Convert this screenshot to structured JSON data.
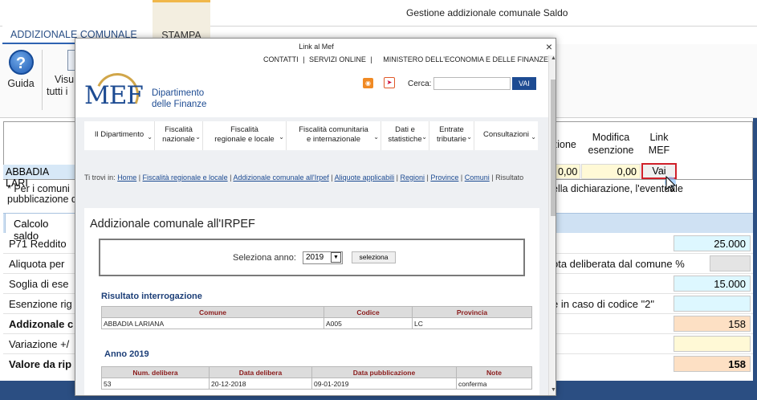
{
  "app": {
    "title": "Gestione addizionale comunale Saldo",
    "tabs": [
      "ADDIZIONALE COMUNALE",
      "STAMPA"
    ],
    "ribbon": {
      "guida": "Guida",
      "visual_line1": "Visu",
      "visual_line2": "tutti i"
    },
    "grid": {
      "headers": {
        "col_a": "zione",
        "col_b_1": "Modifica",
        "col_b_2": "esenzione",
        "col_c_1": "Link",
        "col_c_2": "MEF"
      },
      "row": {
        "comune": "ABBADIA LARI",
        "val_a": "0,00",
        "val_b": "0,00",
        "link": "Vai"
      },
      "note_1": "* Per i comuni",
      "note_1_right": "ella dichiarazione, l'eventuale",
      "note_2": "pubblicazione d"
    },
    "calc": {
      "tab": "Calcolo saldo",
      "rows": [
        {
          "label": "P71 Reddito",
          "right_label": "",
          "value": "25.000",
          "bold": false
        },
        {
          "label": "Aliquota per",
          "right_label": "ota deliberata dal comune %",
          "value": "",
          "bold": false
        },
        {
          "label": "Soglia di ese",
          "right_label": "",
          "value": "15.000",
          "bold": false
        },
        {
          "label": "Esenzione rig",
          "right_label": "e in caso di codice \"2\"",
          "value": "",
          "bold": false
        },
        {
          "label": "Addizonale c",
          "right_label": "",
          "value": "158",
          "bold": true
        },
        {
          "label": "Variazione +/",
          "right_label": "",
          "value": "",
          "bold": false
        },
        {
          "label": "Valore da rip",
          "right_label": "",
          "value": "158",
          "bold": true
        }
      ]
    }
  },
  "modal": {
    "title": "Link al Mef",
    "close": "×",
    "top_links": [
      "CONTATTI",
      "|",
      "SERVIZI ONLINE",
      "|",
      "MINISTERO DELL'ECONOMIA E DELLE FINANZE"
    ],
    "logo": {
      "mef": "MEF",
      "line1": "Dipartimento",
      "line2": "delle Finanze"
    },
    "search": {
      "label": "Cerca:",
      "button": "VAI",
      "placeholder": ""
    },
    "menu": [
      {
        "l1": "Il Dipartimento",
        "l2": ""
      },
      {
        "l1": "Fiscalità",
        "l2": "nazionale"
      },
      {
        "l1": "Fiscalità",
        "l2": "regionale e locale"
      },
      {
        "l1": "Fiscalità comunitaria",
        "l2": "e internazionale"
      },
      {
        "l1": "Dati e",
        "l2": "statistiche"
      },
      {
        "l1": "Entrate",
        "l2": "tributarie"
      },
      {
        "l1": "Consultazioni",
        "l2": ""
      }
    ],
    "breadcrumb": {
      "prefix": "Ti trovi in:",
      "items": [
        "Home",
        "Fiscalità regionale e locale",
        "Addizionale comunale all'Irpef",
        "Aliquote applicabili",
        "Regioni",
        "Province",
        "Comuni"
      ],
      "current": "Risultato"
    },
    "heading": "Addizionale comunale all'IRPEF",
    "year_selector": {
      "label": "Seleziona anno:",
      "value": "2019",
      "button": "seleziona"
    },
    "result": {
      "title": "Risultato interrogazione",
      "headers": [
        "Comune",
        "Codice",
        "Provincia"
      ],
      "row": [
        "ABBADIA LARIANA",
        "A005",
        "LC"
      ]
    },
    "year_section": {
      "title": "Anno 2019",
      "headers": [
        "Num. delibera",
        "Data delibera",
        "Data pubblicazione",
        "Note"
      ],
      "row": [
        "53",
        "20-12-2018",
        "09-01-2019",
        "conferma"
      ]
    }
  },
  "colors": {
    "accent_blue": "#1d4b92",
    "link_red": "#d0202a",
    "yellow_cell": "#fff9d6",
    "orange_cell": "#fde0c4",
    "cyan_cell": "#ddf7ff"
  }
}
